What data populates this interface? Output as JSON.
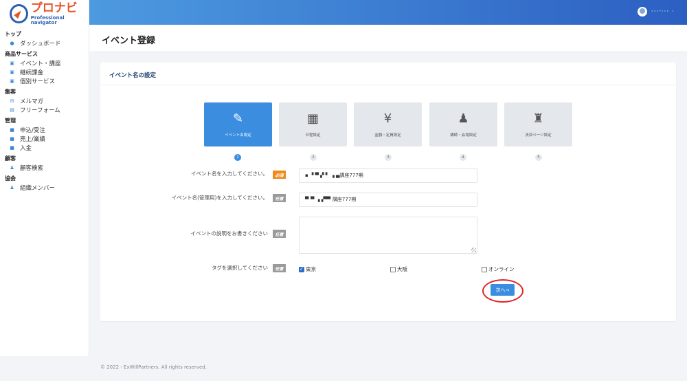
{
  "brand": {
    "name": "プロナビ",
    "tagline": "Professional navigator"
  },
  "user": {
    "name": "···ᐧ··· ·"
  },
  "sidebar": {
    "sections": [
      {
        "heading": "トップ",
        "items": [
          {
            "label": "ダッシュボード",
            "icon": "dashboard-icon"
          }
        ]
      },
      {
        "heading": "商品サービス",
        "items": [
          {
            "label": "イベント・講座",
            "icon": "calendar-icon"
          },
          {
            "label": "継続課金",
            "icon": "calendar-icon"
          },
          {
            "label": "個別サービス",
            "icon": "calendar-icon"
          }
        ]
      },
      {
        "heading": "集客",
        "items": [
          {
            "label": "メルマガ",
            "icon": "mail-icon"
          },
          {
            "label": "フリーフォーム",
            "icon": "form-icon"
          }
        ]
      },
      {
        "heading": "管理",
        "items": [
          {
            "label": "申込/受注",
            "icon": "folder-icon"
          },
          {
            "label": "売上/業績",
            "icon": "folder-icon"
          },
          {
            "label": "入金",
            "icon": "folder-icon"
          }
        ]
      },
      {
        "heading": "顧客",
        "items": [
          {
            "label": "顧客検索",
            "icon": "users-icon"
          }
        ]
      },
      {
        "heading": "協会",
        "items": [
          {
            "label": "組織メンバー",
            "icon": "user-icon"
          }
        ]
      }
    ]
  },
  "page": {
    "title": "イベント登録"
  },
  "card": {
    "title": "イベント名の設定"
  },
  "steps": [
    {
      "label": "イベント名設定",
      "num": "1",
      "icon": "edit-icon",
      "active": true
    },
    {
      "label": "日程設定",
      "num": "2",
      "icon": "calendar-icon",
      "active": false
    },
    {
      "label": "金額・定員設定",
      "num": "3",
      "icon": "yen-icon",
      "active": false
    },
    {
      "label": "講師・会場設定",
      "num": "4",
      "icon": "location-icon",
      "active": false
    },
    {
      "label": "決済ページ設定",
      "num": "5",
      "icon": "stamp-icon",
      "active": false
    }
  ],
  "form": {
    "event_name": {
      "label": "イベント名を入力してください。",
      "badge": "必須",
      "value": "▪ ▝ ▀ ▞ ▘ ▗ ▄講座777期"
    },
    "admin_name": {
      "label": "イベント名(管理用)を入力してください。",
      "badge": "任意",
      "value": "▀▝▘▗ ▞▀▘講座777期"
    },
    "description": {
      "label": "イベントの説明をお書きください",
      "badge": "任意",
      "value": ""
    },
    "tags": {
      "label": "タグを選択してください",
      "badge": "任意",
      "options": [
        {
          "label": "東京",
          "checked": true
        },
        {
          "label": "大阪",
          "checked": false
        },
        {
          "label": "オンライン",
          "checked": false
        }
      ]
    }
  },
  "next_button": "次へ→",
  "footer": "© 2022 - ExWillPartners. All rights reserved.",
  "colors": {
    "primary": "#3b8de0",
    "required": "#ef8a1c",
    "optional": "#9a9a9a",
    "highlight": "#e02424"
  }
}
